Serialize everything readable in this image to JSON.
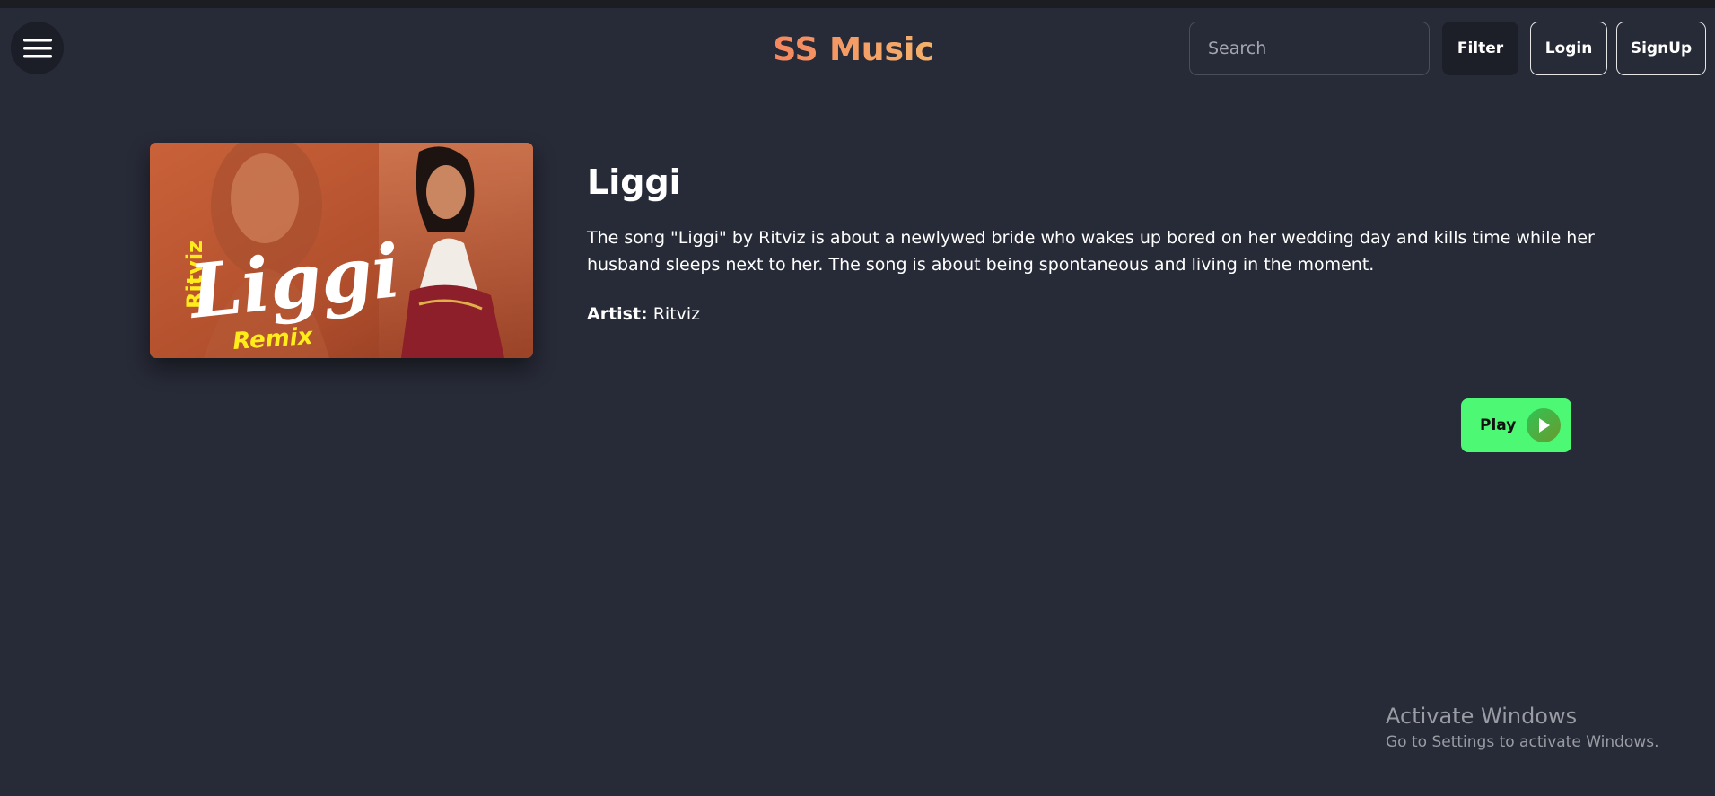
{
  "header": {
    "brand": "SS Music",
    "search_placeholder": "Search",
    "filter_label": "Filter",
    "login_label": "Login",
    "signup_label": "SignUp",
    "menu_icon": "hamburger-menu-icon"
  },
  "song": {
    "title": "Liggi",
    "description": "The song \"Liggi\" by Ritviz is about a newlywed bride who wakes up bored on her wedding day and kills time while her husband sleeps next to her. The song is about being spontaneous and living in the moment.",
    "artist_label": "Artist:",
    "artist_name": "Ritviz",
    "play_label": "Play",
    "play_icon": "play-icon",
    "cover": {
      "artist_text": "Ritviz",
      "title_text": "Liggi",
      "subtitle_text": "Remix"
    }
  },
  "watermark": {
    "title": "Activate Windows",
    "subtitle": "Go to Settings to activate Windows."
  },
  "colors": {
    "background": "#272a37",
    "brand_start": "#f5865f",
    "brand_end": "#f3b36b",
    "play_button": "#4df874"
  }
}
